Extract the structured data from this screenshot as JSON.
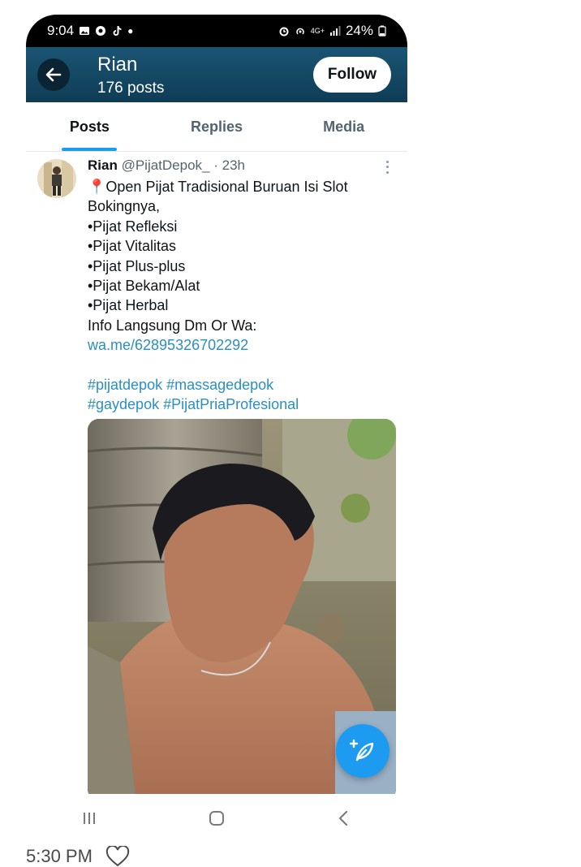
{
  "status_bar": {
    "time": "9:04",
    "network": "4G+",
    "battery": "24%"
  },
  "header": {
    "name": "Rian",
    "post_count": "176 posts",
    "follow_label": "Follow"
  },
  "tabs": [
    {
      "label": "Posts",
      "active": true
    },
    {
      "label": "Replies",
      "active": false
    },
    {
      "label": "Media",
      "active": false
    }
  ],
  "post": {
    "author_name": "Rian",
    "handle": "@PijatDepok_",
    "time_ago": "· 23h",
    "lines": [
      "📍Open Pijat Tradisional Buruan Isi Slot",
      "Bokingnya,",
      "•Pijat Refleksi",
      "•Pijat Vitalitas",
      "•Pijat Plus-plus",
      "•Pijat Bekam/Alat",
      "•Pijat Herbal",
      "Info Langsung Dm Or Wa:"
    ],
    "link": "wa.me/62895326702292",
    "hashtags_line1": "#pijatdepok #massagedepok",
    "hashtags_line2": "#gaydepok #PijatPriaProfesional"
  },
  "outside": {
    "time": "5:30 PM"
  },
  "colors": {
    "accent": "#1d9bf0",
    "header_bg": "#15506d"
  }
}
